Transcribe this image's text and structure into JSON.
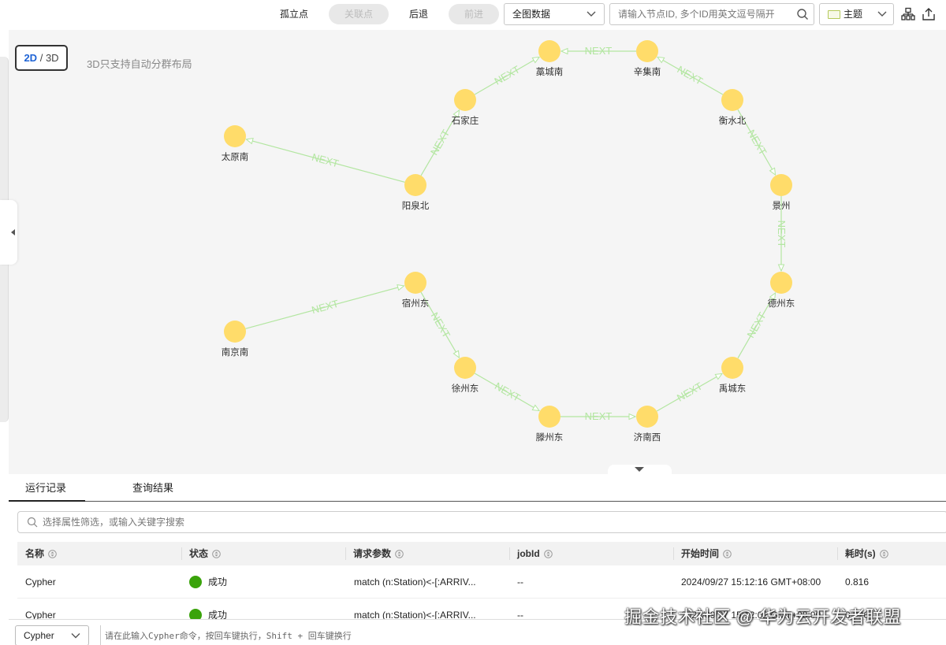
{
  "toolbar": {
    "isolated_label": "孤立点",
    "related_label": "关联点",
    "back_label": "后退",
    "forward_label": "前进",
    "scope_value": "全图数据",
    "search_placeholder": "请输入节点ID, 多个ID用英文逗号隔开",
    "theme_label": "主题"
  },
  "canvas": {
    "mode_2d": "2D",
    "mode_sep": "/",
    "mode_3d": "3D",
    "hint": "3D只支持自动分群布局"
  },
  "graph": {
    "node_color": "#ffdc6a",
    "edge_color": "#b3e6a1",
    "nodes": [
      {
        "id": "taiyuannan",
        "label": "太原南"
      },
      {
        "id": "yangquanbei",
        "label": "阳泉北"
      },
      {
        "id": "shijiazhuang",
        "label": "石家庄"
      },
      {
        "id": "gaochengnan",
        "label": "藁城南"
      },
      {
        "id": "xinjinan",
        "label": "辛集南"
      },
      {
        "id": "hengshuibei",
        "label": "衡水北"
      },
      {
        "id": "jingzhou",
        "label": "景州"
      },
      {
        "id": "dezhoudong",
        "label": "德州东"
      },
      {
        "id": "yuchengdong",
        "label": "禹城东"
      },
      {
        "id": "jinanxi",
        "label": "济南西"
      },
      {
        "id": "tengzhoudong",
        "label": "滕州东"
      },
      {
        "id": "xuzhoudong",
        "label": "徐州东"
      },
      {
        "id": "suzhoudong",
        "label": "宿州东"
      },
      {
        "id": "nanjingnan",
        "label": "南京南"
      }
    ],
    "edges": [
      {
        "from": "yangquanbei",
        "to": "taiyuannan",
        "label": "NEXT"
      },
      {
        "from": "yangquanbei",
        "to": "shijiazhuang",
        "label": "NEXT"
      },
      {
        "from": "shijiazhuang",
        "to": "gaochengnan",
        "label": "NEXT"
      },
      {
        "from": "xinjinan",
        "to": "gaochengnan",
        "label": "NEXT"
      },
      {
        "from": "hengshuibei",
        "to": "xinjinan",
        "label": "NEXT"
      },
      {
        "from": "hengshuibei",
        "to": "jingzhou",
        "label": "NEXT"
      },
      {
        "from": "jingzhou",
        "to": "dezhoudong",
        "label": "NEXT"
      },
      {
        "from": "yuchengdong",
        "to": "dezhoudong",
        "label": "NEXT"
      },
      {
        "from": "jinanxi",
        "to": "yuchengdong",
        "label": "NEXT"
      },
      {
        "from": "tengzhoudong",
        "to": "jinanxi",
        "label": "NEXT"
      },
      {
        "from": "xuzhoudong",
        "to": "tengzhoudong",
        "label": "NEXT"
      },
      {
        "from": "suzhoudong",
        "to": "xuzhoudong",
        "label": "NEXT"
      },
      {
        "from": "nanjingnan",
        "to": "suzhoudong",
        "label": "NEXT"
      }
    ]
  },
  "panel": {
    "tabs": [
      "运行记录",
      "查询结果"
    ],
    "filter_placeholder": "选择属性筛选，或输入关键字搜索",
    "columns": [
      "名称",
      "状态",
      "请求参数",
      "jobId",
      "开始时间",
      "耗时(s)"
    ],
    "rows": [
      {
        "name": "Cypher",
        "status": "成功",
        "params": "match (n:Station)<-[:ARRIV...",
        "job_id": "--",
        "start": "2024/09/27 15:12:16 GMT+08:00",
        "duration": "0.816"
      },
      {
        "name": "Cypher",
        "status": "成功",
        "params": "match (n:Station)<-[:ARRIV...",
        "job_id": "--",
        "start": "2024/09/27 15:12:02 GMT+08:00",
        "duration": "0.826"
      }
    ]
  },
  "cmdbar": {
    "language": "Cypher",
    "placeholder": "请在此输入Cypher命令，按回车键执行，Shift + 回车键换行"
  },
  "watermark": "掘金技术社区 @ 华为云开发者联盟"
}
